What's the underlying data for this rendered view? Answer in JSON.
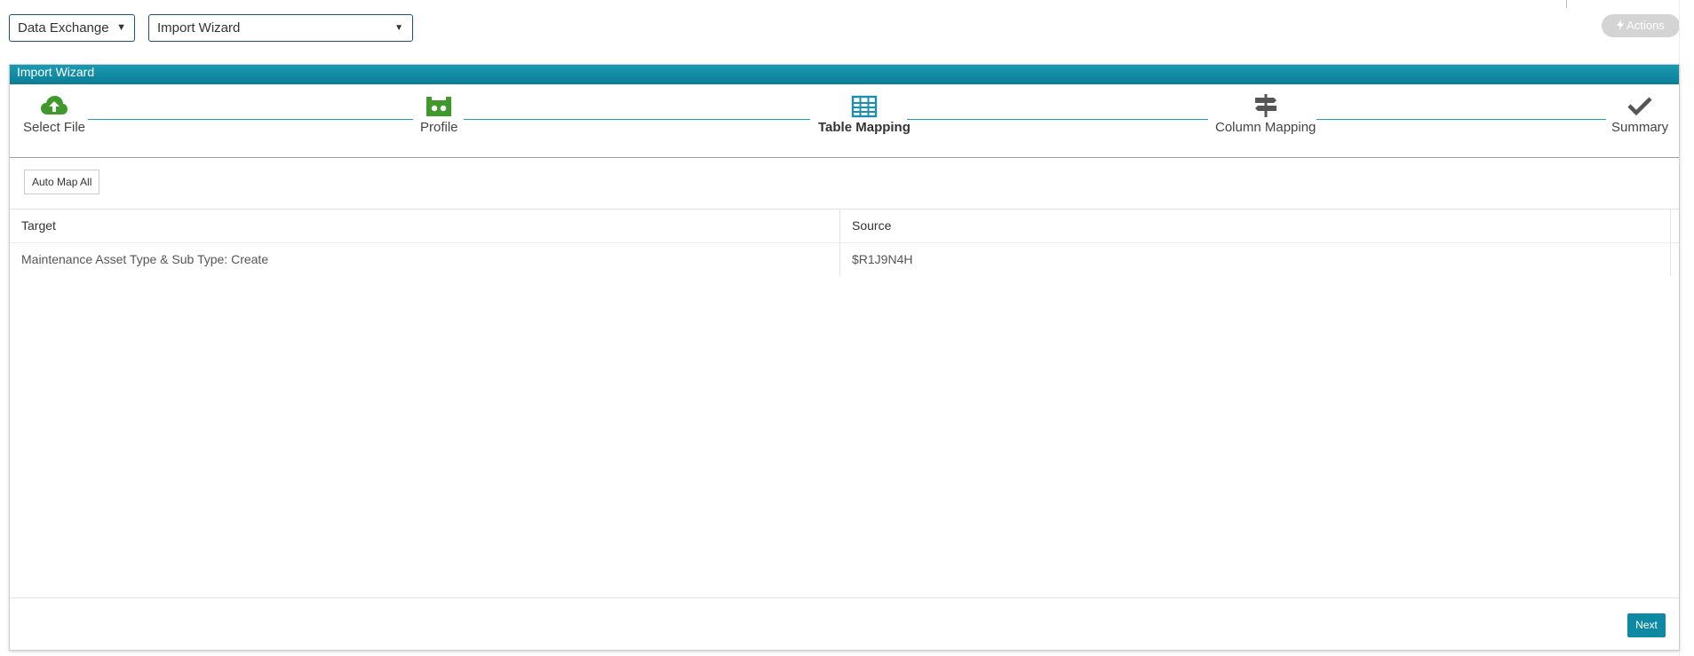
{
  "topbar": {
    "module_select": "Data Exchange",
    "view_select": "Import Wizard",
    "actions_label": "Actions"
  },
  "panel": {
    "title": "Import Wizard",
    "steps": [
      {
        "label": "Select File",
        "icon": "cloud-upload-icon"
      },
      {
        "label": "Profile",
        "icon": "profile-icon"
      },
      {
        "label": "Table Mapping",
        "icon": "table-icon",
        "active": true
      },
      {
        "label": "Column Mapping",
        "icon": "signpost-icon"
      },
      {
        "label": "Summary",
        "icon": "checkmark-icon"
      }
    ],
    "auto_map_label": "Auto Map All",
    "table": {
      "columns": [
        "Target",
        "Source"
      ],
      "rows": [
        [
          "Maintenance Asset Type & Sub Type: Create",
          "$R1J9N4H"
        ]
      ]
    },
    "next_label": "Next"
  },
  "colors": {
    "header_teal": "#0b7d96",
    "button_teal": "#0e89a3",
    "step_green": "#3f9a2b",
    "step_active_blue": "#1b8fb0",
    "step_gray": "#555555",
    "select_border": "#1f4e79"
  }
}
